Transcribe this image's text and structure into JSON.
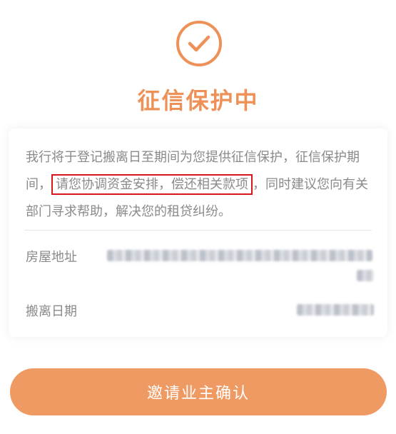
{
  "status": {
    "icon": "check-circle-icon",
    "title": "征信保护中",
    "accent_color": "#ee9158"
  },
  "notice": {
    "before": "我行将于登记搬离日至期间为您提供征信保护，征信保护期间，",
    "highlight": "请您协调资金安排，偿还相关款项",
    "after": "，同时建议您向有关部门寻求帮助，解决您的租贷纠纷。",
    "highlight_border_color": "#d8151a"
  },
  "details": {
    "address_label": "房屋地址",
    "date_label": "搬离日期"
  },
  "action": {
    "confirm_label": "邀请业主确认",
    "button_color": "#f09a63"
  }
}
